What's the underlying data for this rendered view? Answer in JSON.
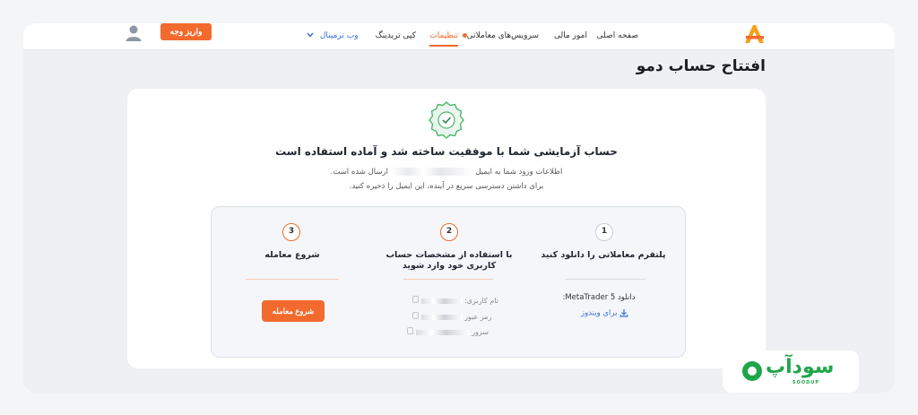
{
  "header": {
    "logo_label": "A",
    "nav": [
      "صفحه اصلی",
      "امور مالی",
      "سرویس‌های معاملاتی",
      "تنظیمات",
      "کپی تریدینگ"
    ],
    "web_terminal": "وب ترمینال",
    "deposit_label": "واریز وجه",
    "accent_color": "#f26a2e"
  },
  "page": {
    "title": "افتتاح حساب دمو"
  },
  "card": {
    "success_title": "حساب آزمایشی شما با موفقیت ساخته شد و آماده استفاده است",
    "info_before": "اطلاعات ورود شما به ایمیل",
    "info_after": "ارسال شده است.",
    "info_line2": "برای داشتن دسترسی سریع در آینده، این ایمیل را ذخیره کنید."
  },
  "steps": [
    {
      "number": "1",
      "title": "پلتفرم معاملاتی را دانلود کنید",
      "download_label": "دانلود MetaTrader 5:",
      "windows_link": "برای ویندوز"
    },
    {
      "number": "2",
      "title_line1": "با استفاده از مشخصات حساب",
      "title_line2": "کاربری خود وارد شوید",
      "credentials": [
        "نام کاربری:",
        "رمز عبور",
        "سرور"
      ]
    },
    {
      "number": "3",
      "title": "شروع معامله",
      "button": "شروع معامله"
    }
  ],
  "watermark": {
    "fa": "سودآپ",
    "en": "SOODUP"
  }
}
